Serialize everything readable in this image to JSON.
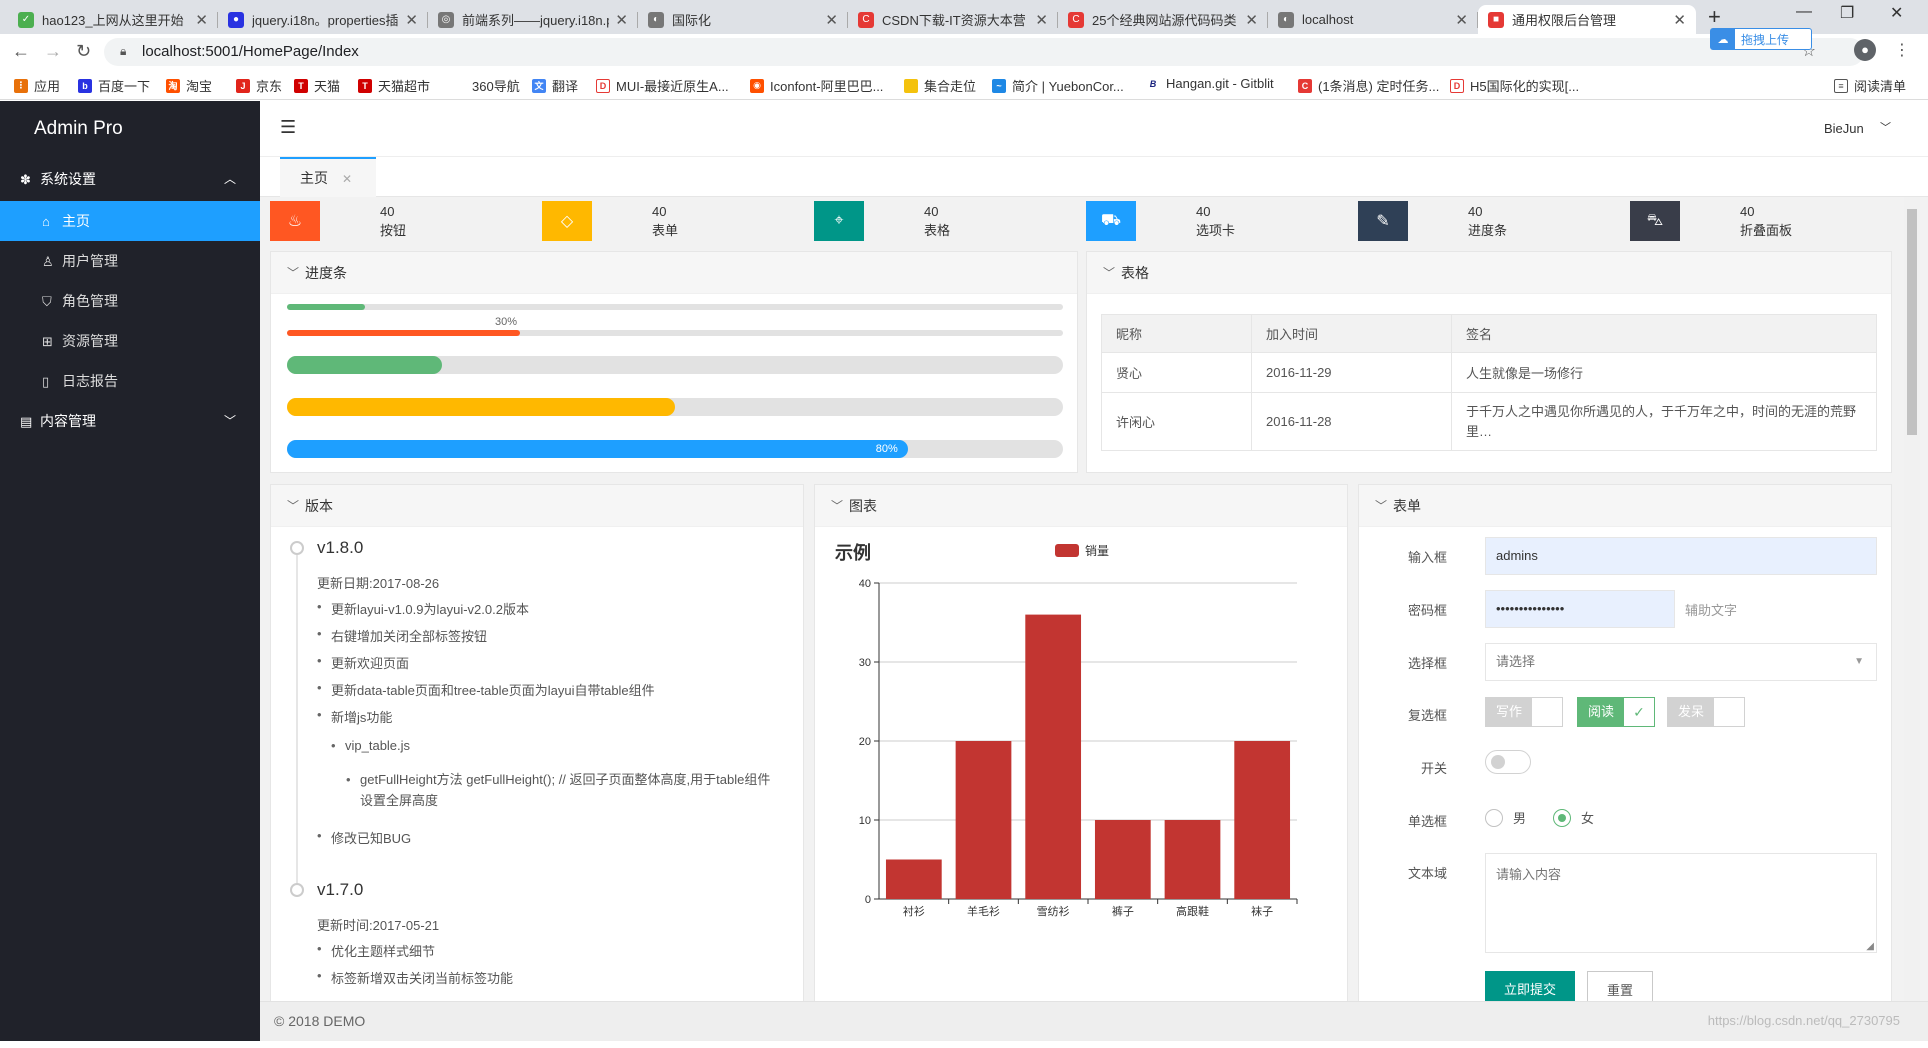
{
  "browser": {
    "tabs": [
      {
        "title": "hao123_上网从这里开始",
        "fav_color": "#4caf50"
      },
      {
        "title": "jquery.i18n。properties插",
        "fav_color": "#2932e1"
      },
      {
        "title": "前端系列——jquery.i18n.p",
        "fav_color": "#555555"
      },
      {
        "title": "国际化",
        "fav_color": "#555555"
      },
      {
        "title": "CSDN下载-IT资源大本营",
        "fav_color": "#e53935"
      },
      {
        "title": "25个经典网站源代码码类",
        "fav_color": "#e53935"
      },
      {
        "title": "localhost",
        "fav_color": "#555555"
      },
      {
        "title": "通用权限后台管理",
        "fav_color": "#e53935"
      }
    ],
    "new_tab": "+",
    "window_controls": {
      "minimize": "—",
      "restore": "❐",
      "close": "✕"
    },
    "url": "localhost:5001/HomePage/Index",
    "baidu_upload": "拖拽上传",
    "bookmarks": [
      {
        "label": "应用",
        "color": "#e8710a"
      },
      {
        "label": "百度一下",
        "color": "#2932e1"
      },
      {
        "label": "淘宝",
        "color": "#ff5000"
      },
      {
        "label": "京东",
        "color": "#e1251b"
      },
      {
        "label": "天猫",
        "color": "#d00000"
      },
      {
        "label": "天猫超市",
        "color": "#d00000"
      },
      {
        "label": "360导航",
        "color": "#ffffff"
      },
      {
        "label": "翻译",
        "color": "#4285f4"
      },
      {
        "label": "MUI-最接近原生A...",
        "color": "#e53935"
      },
      {
        "label": "Iconfont-阿里巴巴...",
        "color": "#ff5000"
      },
      {
        "label": "集合走位",
        "color": "#f4c20d"
      },
      {
        "label": "简介 | YuebonCor...",
        "color": "#1e88e5"
      },
      {
        "label": "Hangan.git - Gitblit",
        "color": "#1a237e"
      },
      {
        "label": "(1条消息) 定时任务...",
        "color": "#e53935"
      },
      {
        "label": "H5国际化的实现[...",
        "color": "#e53935"
      }
    ],
    "reading_list": "阅读清单"
  },
  "app": {
    "logo": "Admin Pro",
    "user": "BieJun",
    "footer": "© 2018 DEMO",
    "menu": {
      "system": "系统设置",
      "items": [
        "主页",
        "用户管理",
        "角色管理",
        "资源管理",
        "日志报告"
      ],
      "content": "内容管理"
    },
    "home_tab": "主页",
    "stats": [
      {
        "value": "40",
        "label": "按钮",
        "color": "#ff5722"
      },
      {
        "value": "40",
        "label": "表单",
        "color": "#ffb800"
      },
      {
        "value": "40",
        "label": "表格",
        "color": "#009688"
      },
      {
        "value": "40",
        "label": "选项卡",
        "color": "#1e9fff"
      },
      {
        "value": "40",
        "label": "进度条",
        "color": "#2f4056"
      },
      {
        "value": "40",
        "label": "折叠面板",
        "color": "#393d49"
      }
    ],
    "progress": {
      "title": "进度条",
      "bars": [
        {
          "percent": 10,
          "color": "#5fb878",
          "big": false
        },
        {
          "percent": 30,
          "color": "#ff5722",
          "big": false,
          "text": "30%"
        },
        {
          "percent": 20,
          "color": "#5fb878",
          "big": true
        },
        {
          "percent": 50,
          "color": "#ffb800",
          "big": true
        },
        {
          "percent": 80,
          "color": "#1e9fff",
          "big": true,
          "text": "80%"
        }
      ]
    },
    "table": {
      "title": "表格",
      "headers": [
        "昵称",
        "加入时间",
        "签名"
      ],
      "rows": [
        [
          "贤心",
          "2016-11-29",
          "人生就像是一场修行"
        ],
        [
          "许闲心",
          "2016-11-28",
          "于千万人之中遇见你所遇见的人，于千万年之中，时间的无涯的荒野里…"
        ]
      ]
    },
    "version": {
      "title": "版本",
      "v1": {
        "title": "v1.8.0",
        "date": "更新日期:2017-08-26",
        "items": [
          "更新layui-v1.0.9为layui-v2.0.2版本",
          "右键增加关闭全部标签按钮",
          "更新欢迎页面",
          "更新data-table页面和tree-table页面为layui自带table组件",
          "新增js功能"
        ],
        "sub": "vip_table.js",
        "subsub": "getFullHeight方法 getFullHeight(); // 返回子页面整体高度,用于table组件设置全屏高度",
        "last": "修改已知BUG"
      },
      "v2": {
        "title": "v1.7.0",
        "date": "更新时间:2017-05-21",
        "items": [
          "优化主题样式细节",
          "标签新增双击关闭当前标签功能"
        ]
      }
    },
    "chart_panel_title": "图表",
    "form": {
      "title": "表单",
      "input_label": "输入框",
      "input_value": "admins",
      "password_label": "密码框",
      "password_value": "•••••••••••••••",
      "password_aux": "辅助文字",
      "select_label": "选择框",
      "select_placeholder": "请选择",
      "checkbox_label": "复选框",
      "checkboxes": [
        {
          "label": "写作",
          "checked": false
        },
        {
          "label": "阅读",
          "checked": true
        },
        {
          "label": "发呆",
          "checked": false
        }
      ],
      "switch_label": "开关",
      "switch_on": false,
      "radio_label": "单选框",
      "radios": [
        {
          "label": "男",
          "checked": false
        },
        {
          "label": "女",
          "checked": true
        }
      ],
      "textarea_label": "文本域",
      "textarea_placeholder": "请输入内容",
      "submit": "立即提交",
      "reset": "重置"
    },
    "watermark": "https://blog.csdn.net/qq_2730795"
  },
  "chart_data": {
    "type": "bar",
    "title": "示例",
    "categories": [
      "衬衫",
      "羊毛衫",
      "雪纺衫",
      "裤子",
      "高跟鞋",
      "袜子"
    ],
    "series": [
      {
        "name": "销量",
        "values": [
          5,
          20,
          36,
          10,
          10,
          20
        ],
        "color": "#c23531"
      }
    ],
    "ylim": [
      0,
      40
    ],
    "yticks": [
      0,
      10,
      20,
      30,
      40
    ],
    "grid": true,
    "legend": "top-center"
  }
}
